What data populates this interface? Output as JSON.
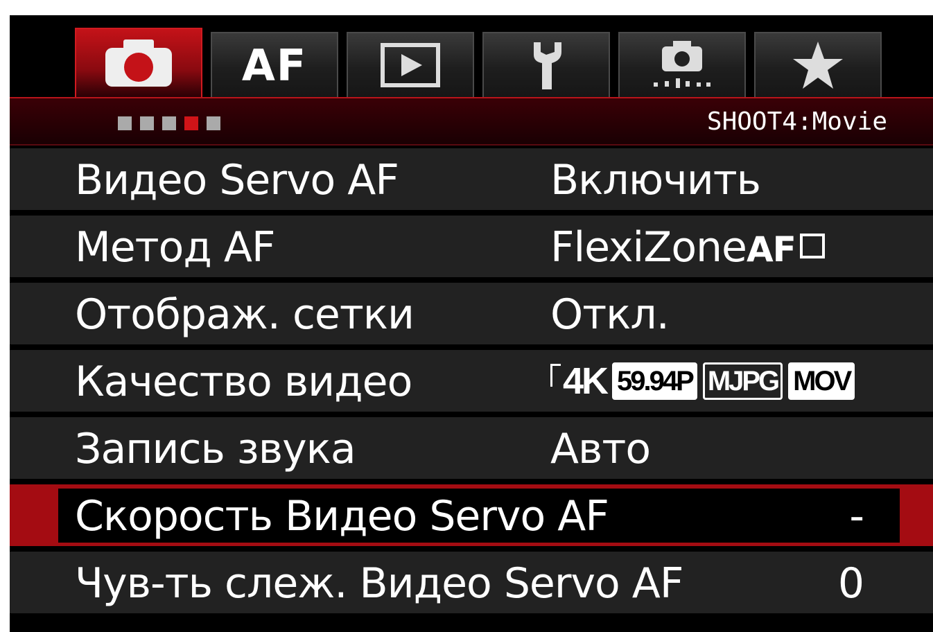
{
  "tabs": [
    {
      "name": "shoot",
      "icon": "camera-icon",
      "active": true
    },
    {
      "name": "af",
      "label": "AF",
      "active": false
    },
    {
      "name": "playback",
      "icon": "play-icon",
      "active": false
    },
    {
      "name": "setup",
      "icon": "wrench-icon",
      "active": false
    },
    {
      "name": "custom",
      "icon": "custom-functions-icon",
      "active": false
    },
    {
      "name": "my-menu",
      "icon": "star-icon",
      "active": false
    }
  ],
  "header": {
    "page_indicator_total": 5,
    "page_indicator_active": 4,
    "page_label": "SHOOT4:Movie"
  },
  "menu": [
    {
      "label": "Видео Servo AF",
      "value": "Включить"
    },
    {
      "label": "Метод AF",
      "value_text": "FlexiZone",
      "value_bold": "AF",
      "value_icon": "single-point-icon"
    },
    {
      "label": "Отображ. сетки",
      "value": "Откл."
    },
    {
      "label": "Качество видео",
      "value_icon": "movie-4k-icon",
      "value_4k": "4K",
      "value_badges": [
        "59.94P",
        "MJPG",
        "MOV"
      ]
    },
    {
      "label": "Запись звука",
      "value": "Авто"
    },
    {
      "label": "Скорость Видео Servo AF",
      "value": "-",
      "selected": true
    },
    {
      "label": "Чув-ть слеж. Видео Servo AF",
      "value": "0"
    }
  ],
  "colors": {
    "accent": "#c41218",
    "row_bg": "#222222",
    "background": "#000000"
  }
}
